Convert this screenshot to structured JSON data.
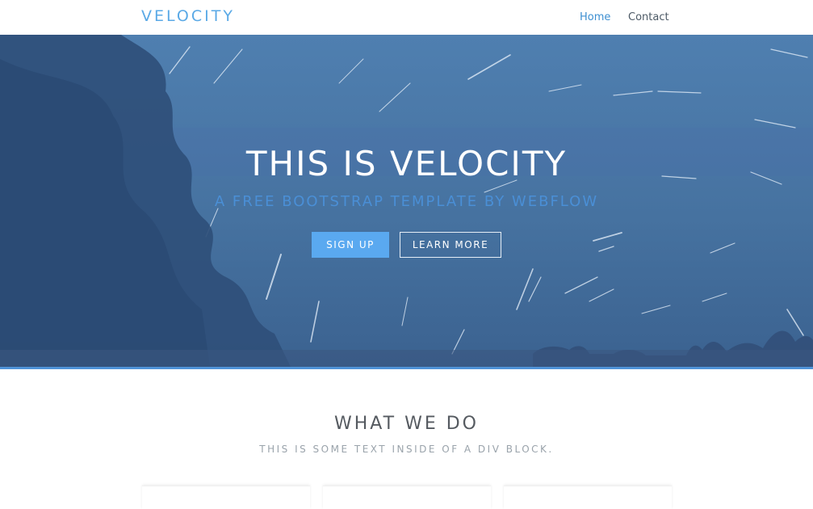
{
  "navbar": {
    "brand": "VELOCITY",
    "links": [
      {
        "label": "Home",
        "active": true
      },
      {
        "label": "Contact",
        "active": false
      }
    ]
  },
  "hero": {
    "title": "THIS IS VELOCITY",
    "subtitle": "A FREE BOOTSTRAP TEMPLATE BY WEBFLOW",
    "signup_label": "SIGN UP",
    "learn_more_label": "LEARN MORE"
  },
  "what_we_do": {
    "title": "WHAT WE DO",
    "text": "THIS IS SOME TEXT INSIDE OF A DIV BLOCK."
  },
  "colors": {
    "accent": "#5aa9f0",
    "brand": "#5aa9e6",
    "hero_bg": "#45719f"
  }
}
